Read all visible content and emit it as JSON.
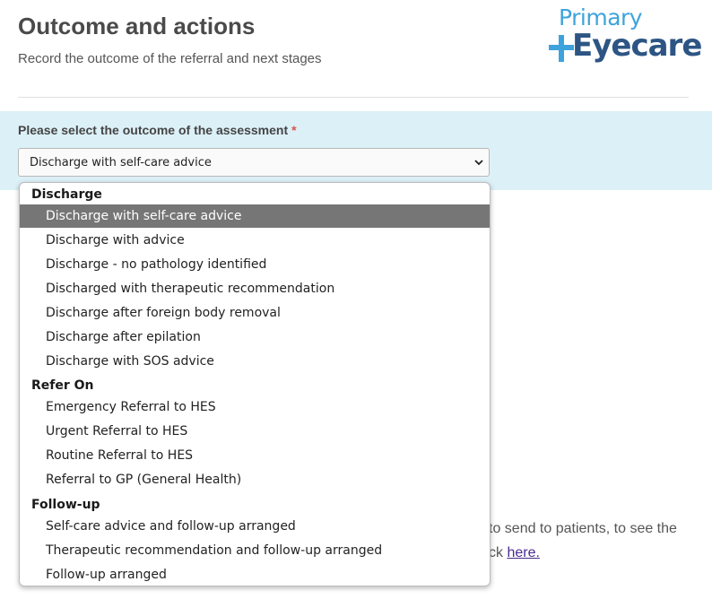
{
  "header": {
    "title": "Outcome and actions",
    "subtitle": "Record the outcome of the referral and next stages",
    "logo": {
      "line1": "Primary",
      "line2": "Eyecare",
      "plus_color": "#3ea3dc",
      "text_color": "#2d5584"
    }
  },
  "question": {
    "label": "Please select the outcome of the assessment",
    "required_marker": "*",
    "selected_value": "Discharge with self-care advice"
  },
  "background_text": {
    "line1": "to send to patients, to see the",
    "line2_prefix": "ck",
    "link": "here."
  },
  "dropdown": {
    "groups": [
      {
        "label": "Discharge",
        "options": [
          "Discharge with self-care advice",
          "Discharge with advice",
          "Discharge - no pathology identified",
          "Discharged with therapeutic recommendation",
          "Discharge after foreign body removal",
          "Discharge after epilation",
          "Discharge with SOS advice"
        ]
      },
      {
        "label": "Refer On",
        "options": [
          "Emergency Referral to HES",
          "Urgent Referral to HES",
          "Routine Referral to HES",
          "Referral to GP (General Health)"
        ]
      },
      {
        "label": "Follow-up",
        "options": [
          "Self-care advice and follow-up arranged",
          "Therapeutic recommendation and follow-up arranged",
          "Follow-up arranged"
        ]
      }
    ],
    "selected_option": "Discharge with self-care advice"
  },
  "colors": {
    "panel_bg": "#dcf0f7",
    "selected_bg": "#767676",
    "required": "#d9534f",
    "link": "#4b2b8f"
  }
}
